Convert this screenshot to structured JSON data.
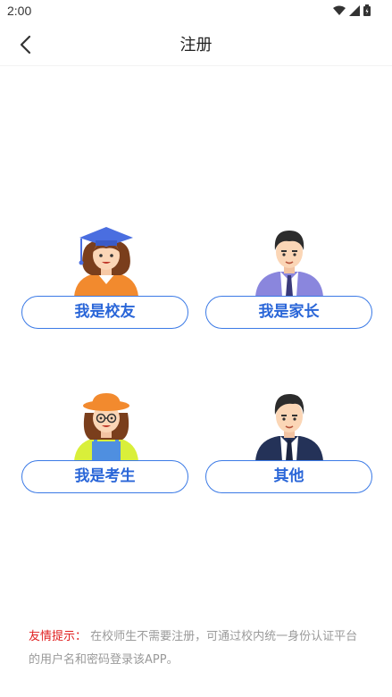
{
  "status": {
    "time": "2:00"
  },
  "nav": {
    "title": "注册"
  },
  "roles": [
    {
      "label": "我是校友"
    },
    {
      "label": "我是家长"
    },
    {
      "label": "我是考生"
    },
    {
      "label": "其他"
    }
  ],
  "tip": {
    "label": "友情提示：",
    "text": "在校师生不需要注册，可通过校内统一身份认证平台的用户名和密码登录该APP。"
  },
  "colors": {
    "accent": "#3b7ae6",
    "tip_label": "#e02020"
  }
}
